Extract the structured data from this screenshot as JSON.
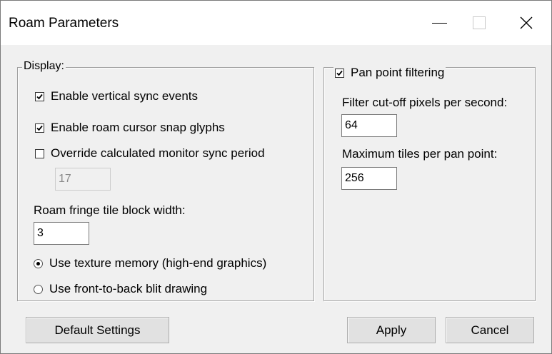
{
  "window": {
    "title": "Roam Parameters"
  },
  "display": {
    "legend": "Display:",
    "vsync": {
      "label": "Enable vertical sync events",
      "checked": true
    },
    "snap": {
      "label": "Enable roam cursor snap glyphs",
      "checked": true
    },
    "override": {
      "label": "Override calculated monitor sync period",
      "checked": false
    },
    "sync_period_value": "17",
    "fringe_label": "Roam fringe tile block width:",
    "fringe_value": "3",
    "texture": {
      "label": "Use texture memory (high-end graphics)",
      "selected": true
    },
    "blit": {
      "label": "Use front-to-back blit drawing",
      "selected": false
    }
  },
  "pan": {
    "legend": "Pan point filtering",
    "checked": true,
    "cutoff_label": "Filter cut-off pixels per second:",
    "cutoff_value": "64",
    "max_tiles_label": "Maximum tiles per pan point:",
    "max_tiles_value": "256"
  },
  "buttons": {
    "default": "Default Settings",
    "apply": "Apply",
    "cancel": "Cancel"
  }
}
